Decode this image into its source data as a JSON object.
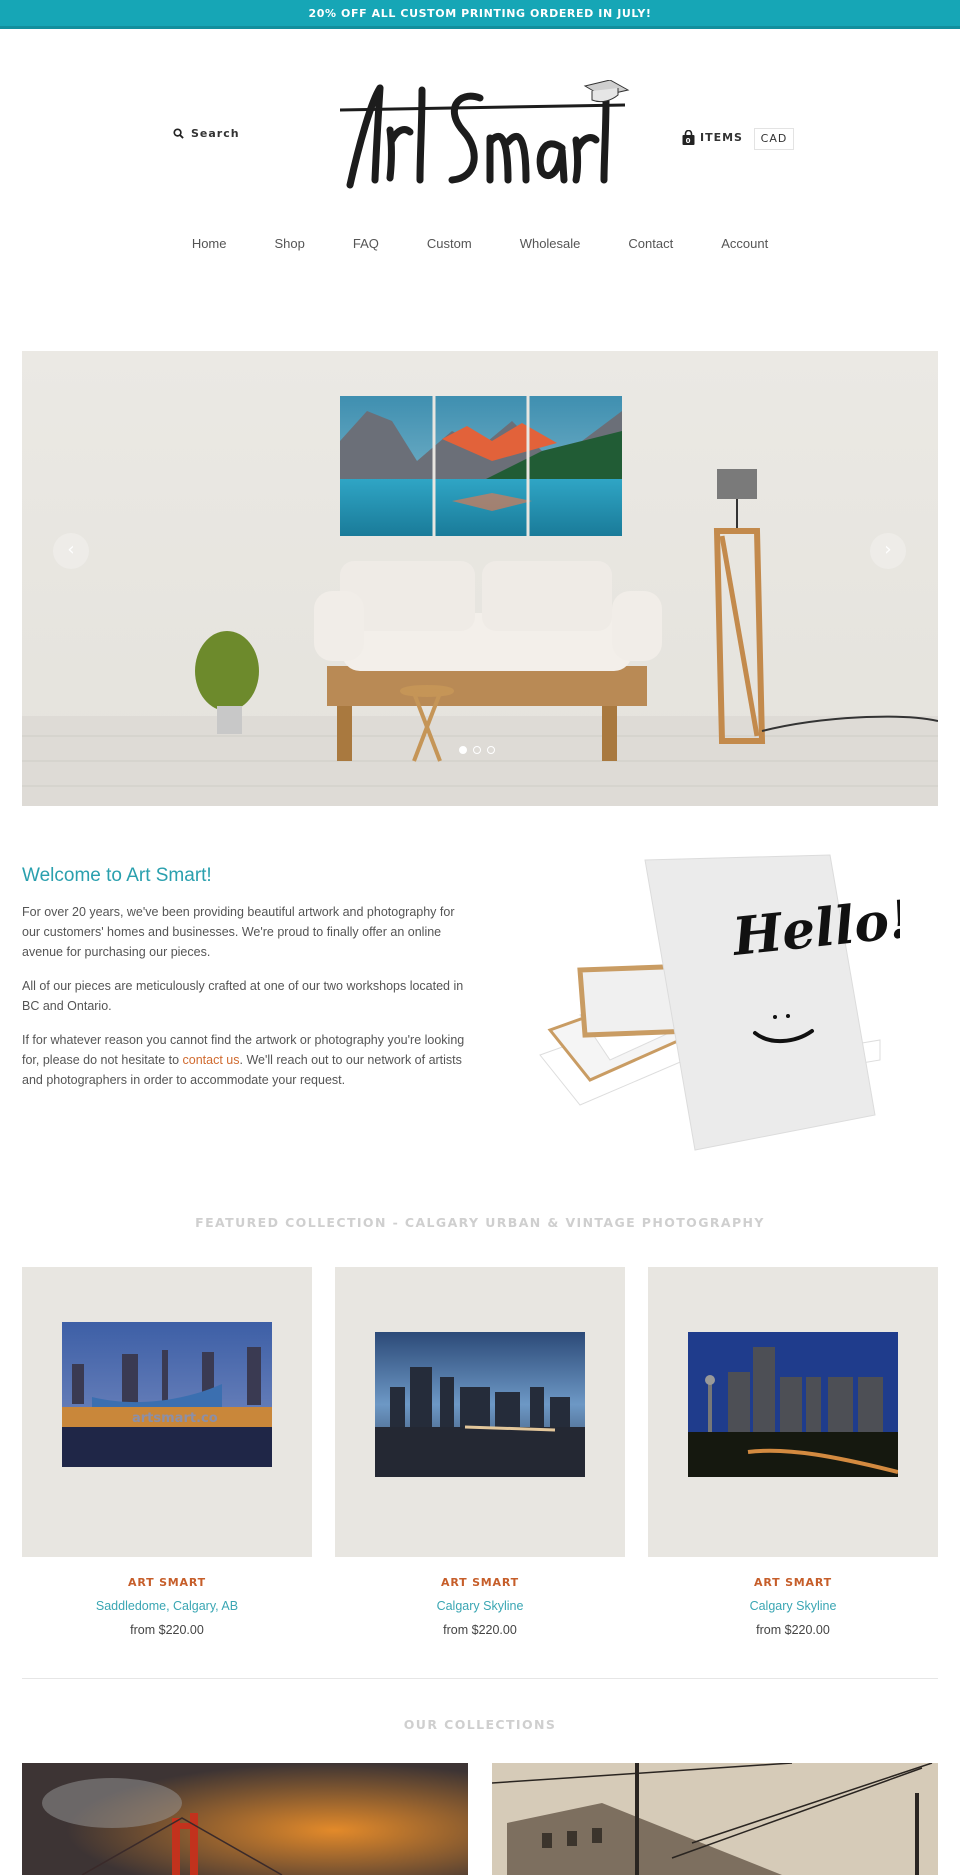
{
  "announcement": "20% OFF ALL CUSTOM PRINTING ORDERED IN JULY!",
  "header": {
    "search_label": "Search",
    "logo_text": "Art Smart",
    "cart_count": "0",
    "cart_label": "ITEMS",
    "currency": "CAD"
  },
  "nav": {
    "items": [
      {
        "label": "Home"
      },
      {
        "label": "Shop"
      },
      {
        "label": "FAQ"
      },
      {
        "label": "Custom"
      },
      {
        "label": "Wholesale"
      },
      {
        "label": "Contact"
      },
      {
        "label": "Account"
      }
    ]
  },
  "hero": {
    "prev_icon": "‹",
    "next_icon": "›",
    "slides_count": 3,
    "active_slide": 1
  },
  "welcome": {
    "title": "Welcome to Art Smart!",
    "p1": "For over 20 years, we've been providing beautiful  artwork and photography for our customers' homes and businesses.  We're proud to finally offer an online avenue for purchasing our pieces.",
    "p2": "All of our pieces are meticulously crafted at one of our two workshops located in BC and Ontario.",
    "p3_before": "If for whatever reason you cannot find the artwork or photography you're looking for, please do not hesitate to ",
    "p3_link": "contact us",
    "p3_after": ". We'll reach out to our network of artists and photographers in order to accommodate your request.",
    "image_text": "Hello!"
  },
  "featured": {
    "title": "FEATURED COLLECTION - CALGARY URBAN & VINTAGE PHOTOGRAPHY",
    "products": [
      {
        "vendor": "ART SMART",
        "title": "Saddledome, Calgary, AB",
        "price": "from $220.00",
        "watermark": "artsmart.co"
      },
      {
        "vendor": "ART SMART",
        "title": "Calgary Skyline",
        "price": "from $220.00"
      },
      {
        "vendor": "ART SMART",
        "title": "Calgary Skyline",
        "price": "from $220.00"
      }
    ]
  },
  "collections": {
    "title": "OUR COLLECTIONS"
  },
  "colors": {
    "accent": "#16a6b6",
    "link_orange": "#d06a2f",
    "vendor_orange": "#c65e2a",
    "title_teal": "#2aa0ae"
  }
}
